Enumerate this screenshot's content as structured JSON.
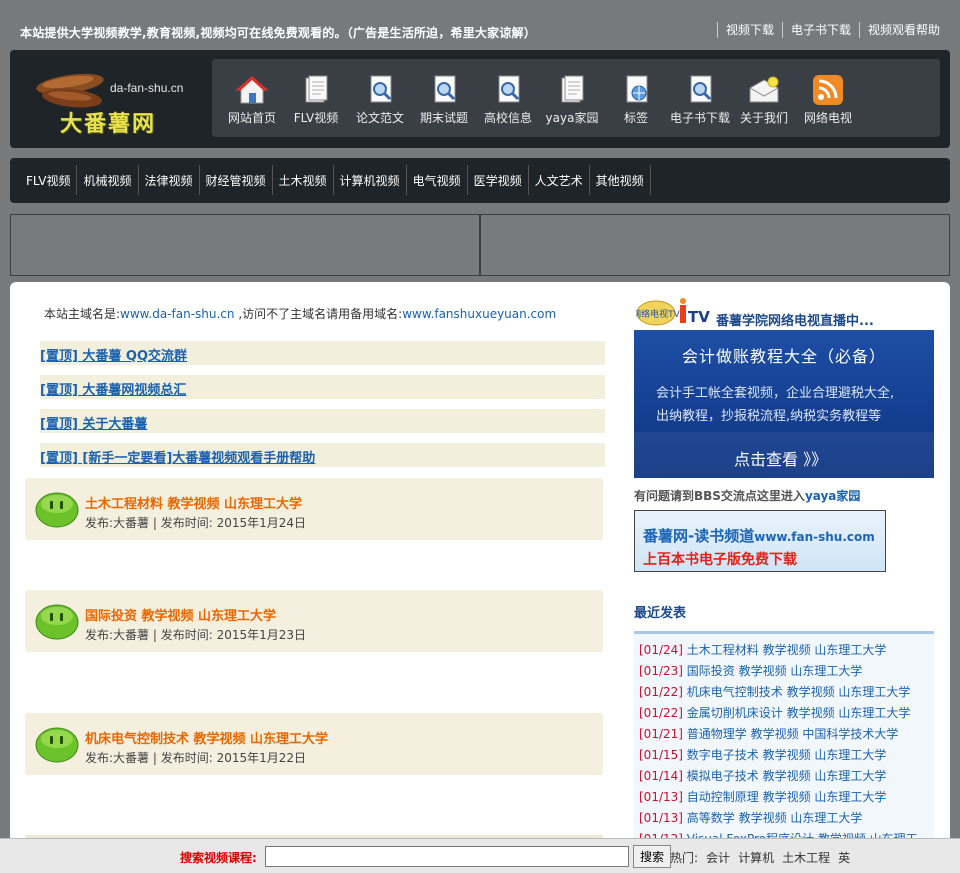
{
  "topbar": {
    "notice": "本站提供大学视频教学,教育视频,视频均可在线免费观看的。（广告是生活所迫，希里大家谅解）",
    "links": [
      "视频下载",
      "电子书下载",
      "视频观看帮助"
    ]
  },
  "logo": {
    "domain": "da-fan-shu.cn",
    "name": "大番薯网"
  },
  "nav": [
    {
      "label": "网站首页",
      "icon": "home-icon"
    },
    {
      "label": "FLV视频",
      "icon": "document-icon"
    },
    {
      "label": "论文范文",
      "icon": "document-search-icon"
    },
    {
      "label": "期末试题",
      "icon": "document-search-icon"
    },
    {
      "label": "高校信息",
      "icon": "document-search-icon"
    },
    {
      "label": "yaya家园",
      "icon": "document-icon"
    },
    {
      "label": "标签",
      "icon": "globe-document-icon"
    },
    {
      "label": "电子书下载",
      "icon": "document-search-icon"
    },
    {
      "label": "关于我们",
      "icon": "mail-icon"
    },
    {
      "label": "网络电视",
      "icon": "rss-icon"
    }
  ],
  "categories": [
    "FLV视频",
    "机械视频",
    "法律视频",
    "财经管视频",
    "土木视频",
    "计算机视频",
    "电气视频",
    "医学视频",
    "人文艺术",
    "其他视频"
  ],
  "domain_note": {
    "prefix": "本站主域名是:",
    "main_domain": "www.da-fan-shu.cn",
    "middle": " ,访问不了主域名请用备用域名:",
    "backup_domain": "www.fanshuxueyuan.com"
  },
  "pinned": [
    "[置顶] 大番薯 QQ交流群",
    "[置顶] 大番薯网视频总汇",
    "[置顶] 关于大番薯",
    "[置顶] [新手一定要看]大番薯视频观看手册帮助"
  ],
  "posts": [
    {
      "title": "土木工程材料 教学视频 山东理工大学",
      "meta": "发布:大番薯 | 发布时间: 2015年1月24日"
    },
    {
      "title": "国际投资 教学视频 山东理工大学",
      "meta": "发布:大番薯 | 发布时间: 2015年1月23日"
    },
    {
      "title": "机床电气控制技术 教学视频 山东理工大学",
      "meta": "发布:大番薯 | 发布时间: 2015年1月22日"
    }
  ],
  "sidebar": {
    "tv_logo_text": "网络电视TV",
    "tv_text": "番薯学院网络电视直播中...",
    "banner": {
      "title": "会计做账教程大全（必备）",
      "line1": "会计手工帐全套视频，企业合理避税大全,",
      "line2": "出纳教程，抄报税流程,纳税实务教程等",
      "cta": "点击查看 》》"
    },
    "bbs_prefix": "有问题请到BBS交流点这里进入",
    "bbs_link": "yaya家园",
    "book": {
      "line1": "番薯网-读书频道",
      "line1_url": "www.fan-shu.com",
      "line2": "上百本书电子版免费下载"
    },
    "recent_heading": "最近发表",
    "recent": [
      {
        "date": "[01/24]",
        "title": "土木工程材料 教学视频 山东理工大学"
      },
      {
        "date": "[01/23]",
        "title": "国际投资 教学视频 山东理工大学"
      },
      {
        "date": "[01/22]",
        "title": "机床电气控制技术 教学视频 山东理工大学"
      },
      {
        "date": "[01/22]",
        "title": "金属切削机床设计 教学视频 山东理工大学"
      },
      {
        "date": "[01/21]",
        "title": "普通物理学 教学视频 中国科学技术大学"
      },
      {
        "date": "[01/15]",
        "title": "数字电子技术 教学视频 山东理工大学"
      },
      {
        "date": "[01/14]",
        "title": "模拟电子技术 教学视频 山东理工大学"
      },
      {
        "date": "[01/13]",
        "title": "自动控制原理 教学视频 山东理工大学"
      },
      {
        "date": "[01/13]",
        "title": "高等数学 教学视频 山东理工大学"
      },
      {
        "date": "[01/12]",
        "title": "Visual FoxPro程序设计 教学视频 山东理工"
      }
    ]
  },
  "search": {
    "label": "搜索视频课程:",
    "value": "",
    "button": "搜索",
    "hot_label": "热门:",
    "hot": [
      "会计",
      "计算机",
      "土木工程",
      "英"
    ]
  }
}
